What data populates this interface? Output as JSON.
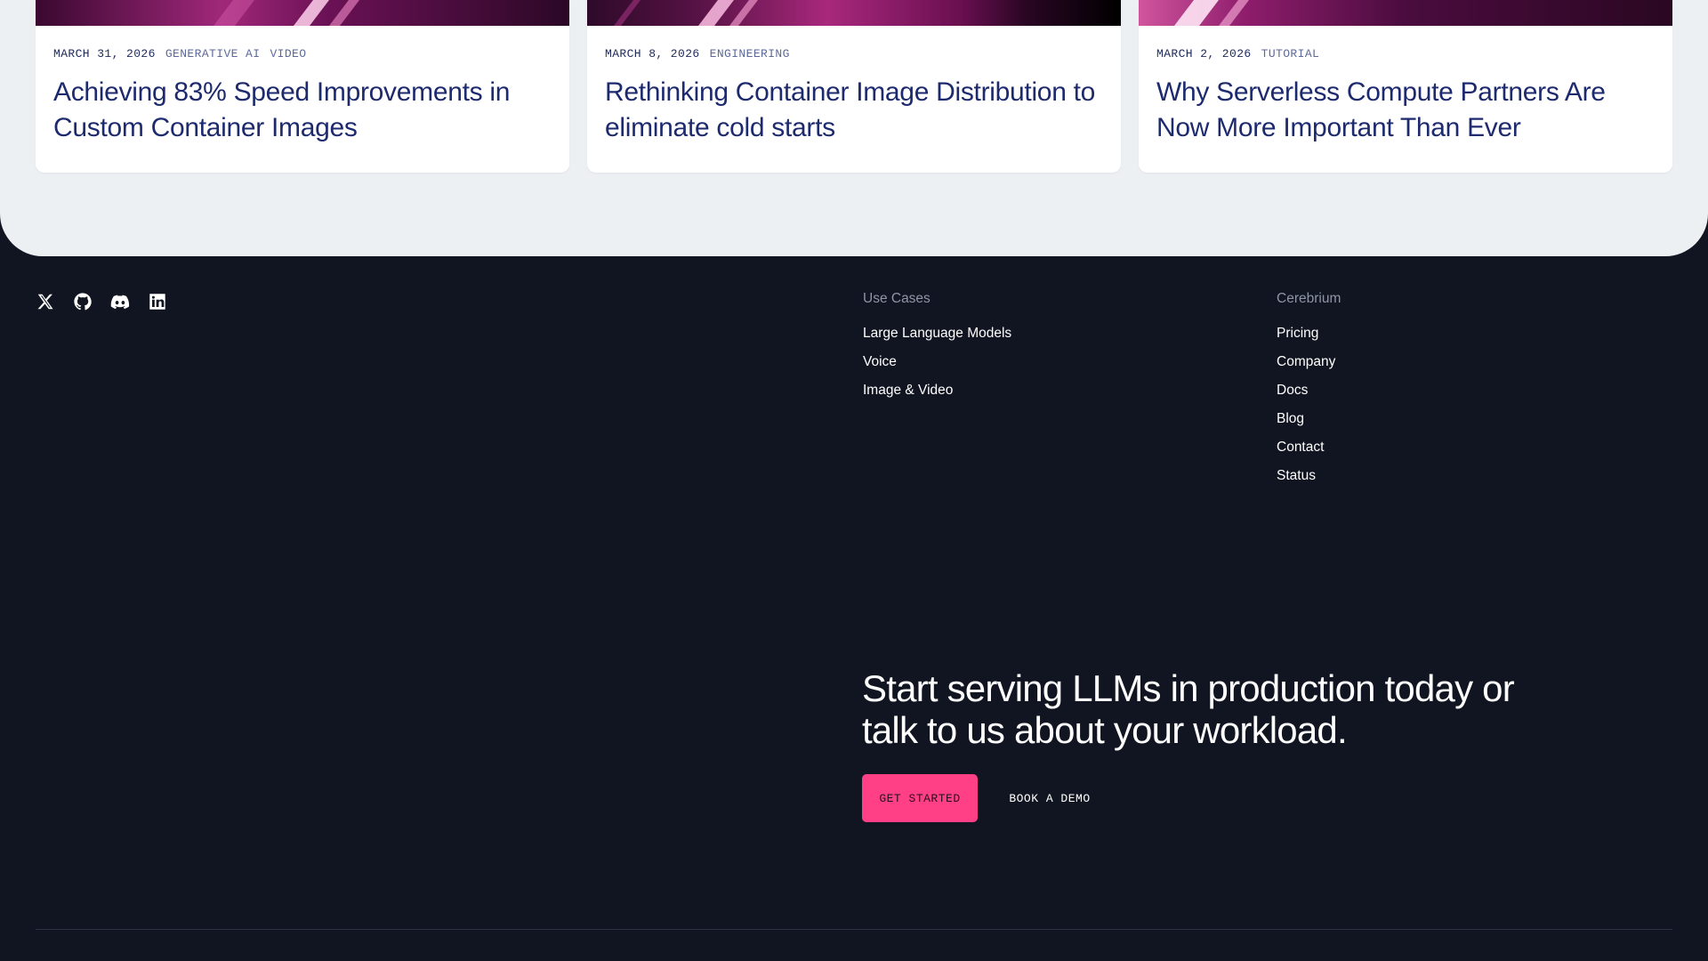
{
  "blog_cards": [
    {
      "date": "MARCH 31, 2026",
      "tags": [
        "GENERATIVE AI",
        "VIDEO"
      ],
      "title": "Achieving 83% Speed Improvements in Custom Container Images"
    },
    {
      "date": "MARCH 8, 2026",
      "tags": [
        "ENGINEERING"
      ],
      "title": "Rethinking Container Image Distribution to eliminate cold starts"
    },
    {
      "date": "MARCH 2, 2026",
      "tags": [
        "TUTORIAL"
      ],
      "title": "Why Serverless Compute Partners Are Now More Important Than Ever"
    }
  ],
  "footer": {
    "social_icons": [
      "x-icon",
      "github-icon",
      "discord-icon",
      "linkedin-icon"
    ],
    "use_cases": {
      "heading": "Use Cases",
      "links": [
        "Large Language Models",
        "Voice",
        "Image & Video"
      ]
    },
    "company": {
      "heading": "Cerebrium",
      "links": [
        "Pricing",
        "Company",
        "Docs",
        "Blog",
        "Contact",
        "Status"
      ]
    },
    "cta": {
      "heading": "Start serving LLMs in production today or talk to us about your workload.",
      "primary_label": "GET STARTED",
      "secondary_label": "BOOK A DEMO"
    }
  },
  "colors": {
    "footer_background": "#111521",
    "page_background": "#edf0f3",
    "accent_pink": "#ff3f86",
    "title_navy": "#1d2a6e"
  }
}
